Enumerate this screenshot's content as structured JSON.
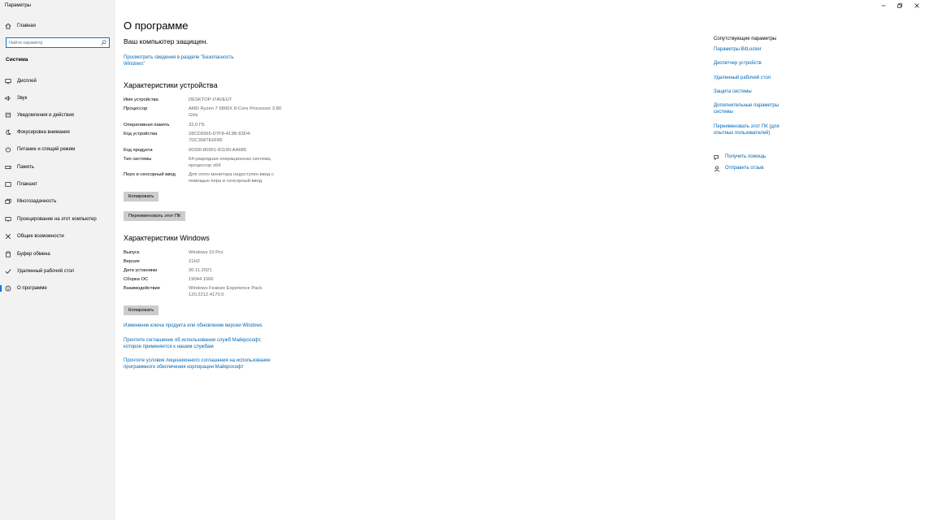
{
  "window": {
    "title": "Параметры"
  },
  "sidebar": {
    "home_label": "Главная",
    "search_placeholder": "Найти параметр",
    "section_label": "Система",
    "items": [
      {
        "label": "Дисплей",
        "icon": "display-icon"
      },
      {
        "label": "Звук",
        "icon": "sound-icon"
      },
      {
        "label": "Уведомления и действия",
        "icon": "notifications-icon"
      },
      {
        "label": "Фокусировка внимания",
        "icon": "focus-assist-icon"
      },
      {
        "label": "Питание и спящий режим",
        "icon": "power-icon"
      },
      {
        "label": "Память",
        "icon": "storage-icon"
      },
      {
        "label": "Планшет",
        "icon": "tablet-icon"
      },
      {
        "label": "Многозадачность",
        "icon": "multitasking-icon"
      },
      {
        "label": "Проецирование на этот компьютер",
        "icon": "projecting-icon"
      },
      {
        "label": "Общие возможности",
        "icon": "shared-experiences-icon"
      },
      {
        "label": "Буфер обмена",
        "icon": "clipboard-icon"
      },
      {
        "label": "Удаленный рабочий стол",
        "icon": "remote-desktop-icon"
      },
      {
        "label": "О программе",
        "icon": "info-icon",
        "selected": true
      }
    ]
  },
  "main": {
    "title": "О программе",
    "protected_text": "Ваш компьютер защищен.",
    "security_link": "Просмотреть сведения в разделе \"Безопасность Windows\"",
    "device_specs": {
      "heading": "Характеристики устройства",
      "rows": [
        {
          "key": "Имя устройства",
          "value": "DESKTOP-I7AVEGT"
        },
        {
          "key": "Процессор",
          "value": "AMD Ryzen 7 5800X 8-Core Processor 3.80 GHz"
        },
        {
          "key": "Оперативная память",
          "value": "32,0 ГБ"
        },
        {
          "key": "Код устройства",
          "value": "28CD9365-D7F8-413B-83D4-7DC3587E6F86"
        },
        {
          "key": "Код продукта",
          "value": "00330-80951-81190-AA685"
        },
        {
          "key": "Тип системы",
          "value": "64-разрядная операционная система, процессор x64"
        },
        {
          "key": "Перо и сенсорный ввод",
          "value": "Для этого монитора недоступен ввод с помощью пера и сенсорный ввод"
        }
      ],
      "copy_label": "Копировать",
      "rename_label": "Переименовать этот ПК"
    },
    "windows_specs": {
      "heading": "Характеристики Windows",
      "rows": [
        {
          "key": "Выпуск",
          "value": "Windows 10 Pro"
        },
        {
          "key": "Версия",
          "value": "21H2"
        },
        {
          "key": "Дата установки",
          "value": "30.11.2021"
        },
        {
          "key": "Сборка ОС",
          "value": "19044.1566"
        },
        {
          "key": "Взаимодействие",
          "value": "Windows Feature Experience Pack 120.2212.4170.0"
        }
      ],
      "copy_label": "Копировать"
    },
    "links": [
      "Изменение ключа продукта или обновление версии Windows",
      "Прочтите соглашение об использовании служб Майкрософт, которое применяется к нашим службам",
      "Прочтите условия лицензионного соглашения на использование программного обеспечения корпорации Майкрософт"
    ]
  },
  "related": {
    "title": "Сопутствующие параметры",
    "links": [
      "Параметры BitLocker",
      "Диспетчер устройств",
      "Удаленный рабочий стол",
      "Защита системы",
      "Дополнительные параметры системы",
      "Переименовать этот ПК (для опытных пользователей)"
    ],
    "help_label": "Получить помощь",
    "feedback_label": "Отправить отзыв"
  },
  "colors": {
    "accent": "#0078d7",
    "link": "#0066b4",
    "sidebar_bg": "#f2f2f2",
    "button_bg": "#cccccc"
  }
}
